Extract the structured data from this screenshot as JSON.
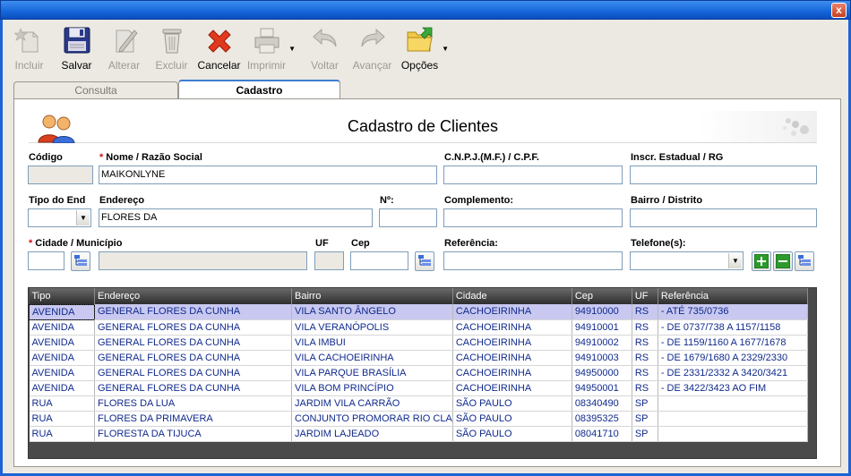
{
  "window": {
    "close_glyph": "x"
  },
  "toolbar": [
    {
      "id": "incluir",
      "label": "Incluir",
      "icon": "add-doc-icon",
      "enabled": false
    },
    {
      "id": "salvar",
      "label": "Salvar",
      "icon": "floppy-disk-icon",
      "enabled": true
    },
    {
      "id": "alterar",
      "label": "Alterar",
      "icon": "edit-doc-icon",
      "enabled": false
    },
    {
      "id": "excluir",
      "label": "Excluir",
      "icon": "trash-icon",
      "enabled": false
    },
    {
      "id": "cancelar",
      "label": "Cancelar",
      "icon": "red-x-icon",
      "enabled": true
    },
    {
      "id": "imprimir",
      "label": "Imprimir",
      "icon": "printer-icon",
      "enabled": false
    },
    {
      "id": "voltar",
      "label": "Voltar",
      "icon": "undo-arrow-icon",
      "enabled": false
    },
    {
      "id": "avancar",
      "label": "Avançar",
      "icon": "redo-arrow-icon",
      "enabled": false
    },
    {
      "id": "opcoes",
      "label": "Opções",
      "icon": "folder-options-icon",
      "enabled": true
    }
  ],
  "tabs": {
    "consulta": "Consulta",
    "cadastro": "Cadastro"
  },
  "form": {
    "title": "Cadastro de Clientes",
    "required_mark": "*",
    "codigo": {
      "label": "Código",
      "value": ""
    },
    "nome": {
      "label": "Nome / Razão Social",
      "value": "MAIKONLYNE"
    },
    "cnpj": {
      "label": "C.N.P.J.(M.F.) / C.P.F.",
      "value": ""
    },
    "inscr": {
      "label": "Inscr. Estadual / RG",
      "value": ""
    },
    "tipo_end": {
      "label": "Tipo do End",
      "value": ""
    },
    "endereco": {
      "label": "Endereço",
      "value": "FLORES DA"
    },
    "numero": {
      "label": "Nº:",
      "value": ""
    },
    "complemento": {
      "label": "Complemento:",
      "value": ""
    },
    "bairro": {
      "label": "Bairro / Distrito",
      "value": ""
    },
    "cidade": {
      "label": "Cidade / Município",
      "code": "",
      "name": ""
    },
    "uf": {
      "label": "UF",
      "value": ""
    },
    "cep": {
      "label": "Cep",
      "value": ""
    },
    "referencia": {
      "label": "Referência:",
      "value": ""
    },
    "telefone": {
      "label": "Telefone(s):",
      "value": ""
    }
  },
  "grid": {
    "columns": [
      "Tipo",
      "Endereço",
      "Bairro",
      "Cidade",
      "Cep",
      "UF",
      "Referência"
    ],
    "rows": [
      [
        "AVENIDA",
        "GENERAL FLORES DA CUNHA",
        "VILA SANTO ÂNGELO",
        "CACHOEIRINHA",
        "94910000",
        "RS",
        "- ATÉ 735/0736"
      ],
      [
        "AVENIDA",
        "GENERAL FLORES DA CUNHA",
        "VILA VERANÓPOLIS",
        "CACHOEIRINHA",
        "94910001",
        "RS",
        "- DE 0737/738 A 1157/1158"
      ],
      [
        "AVENIDA",
        "GENERAL FLORES DA CUNHA",
        "VILA IMBUI",
        "CACHOEIRINHA",
        "94910002",
        "RS",
        "- DE 1159/1160 A 1677/1678"
      ],
      [
        "AVENIDA",
        "GENERAL FLORES DA CUNHA",
        "VILA CACHOEIRINHA",
        "CACHOEIRINHA",
        "94910003",
        "RS",
        "- DE 1679/1680 A 2329/2330"
      ],
      [
        "AVENIDA",
        "GENERAL FLORES DA CUNHA",
        "VILA PARQUE BRASÍLIA",
        "CACHOEIRINHA",
        "94950000",
        "RS",
        "- DE 2331/2332 A 3420/3421"
      ],
      [
        "AVENIDA",
        "GENERAL FLORES DA CUNHA",
        "VILA BOM PRINCÍPIO",
        "CACHOEIRINHA",
        "94950001",
        "RS",
        "- DE 3422/3423 AO FIM"
      ],
      [
        "RUA",
        "FLORES DA LUA",
        "JARDIM VILA CARRÃO",
        "SÃO PAULO",
        "08340490",
        "SP",
        ""
      ],
      [
        "RUA",
        "FLORES DA PRIMAVERA",
        "CONJUNTO PROMORAR RIO CLA",
        "SÃO PAULO",
        "08395325",
        "SP",
        ""
      ],
      [
        "RUA",
        "FLORESTA DA TIJUCA",
        "JARDIM LAJEADO",
        "SÃO PAULO",
        "08041710",
        "SP",
        ""
      ]
    ]
  }
}
